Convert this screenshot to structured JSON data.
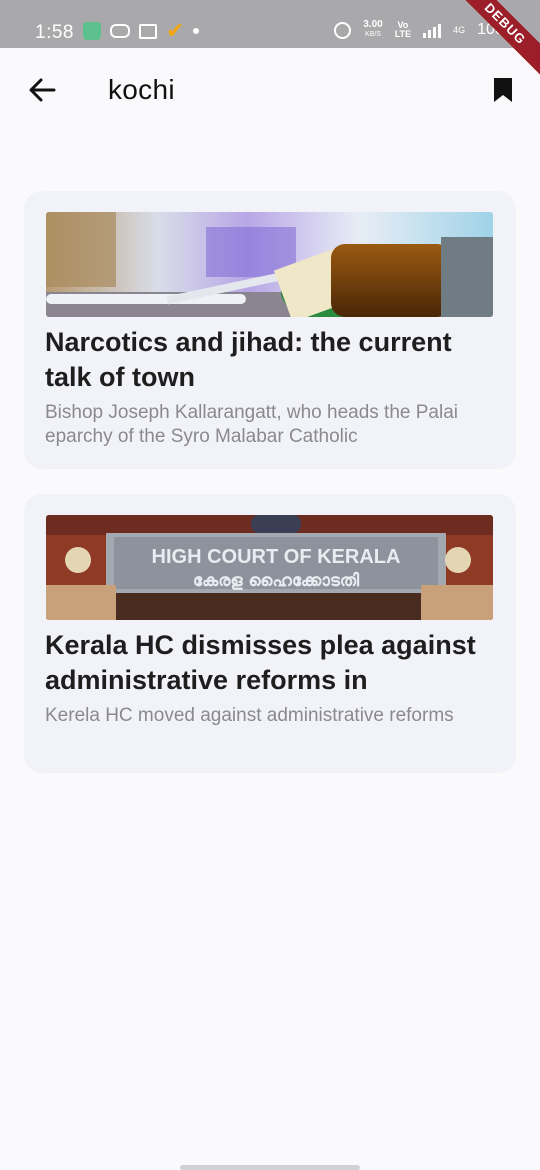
{
  "status_bar": {
    "time": "1:58",
    "speed": "3.00",
    "speed_unit": "KB/S",
    "volte_top": "Vo",
    "volte_bottom": "LTE",
    "network": "4G",
    "battery": "100%"
  },
  "debug_banner": "DEBUG",
  "app_bar": {
    "title": "kochi",
    "back_icon": "arrow-back-icon",
    "bookmark_icon": "bookmark-icon"
  },
  "articles": [
    {
      "title": " Narcotics and jihad: the current talk of town",
      "description": "Bishop Joseph Kallarangatt, who heads the Palai eparchy of the Syro Malabar Catholic"
    },
    {
      "title": "Kerala HC dismisses plea against administrative reforms in",
      "description": "Kerela HC moved against administrative reforms",
      "image_sign_line1": "HIGH COURT OF KERALA",
      "image_sign_line2": "കേരള ഹൈക്കോടതി"
    }
  ],
  "colors": {
    "status_bar": "#a9a9ab",
    "background": "#fafafc",
    "card": "#f2f3f8",
    "debug_ribbon": "#9b1e29"
  }
}
